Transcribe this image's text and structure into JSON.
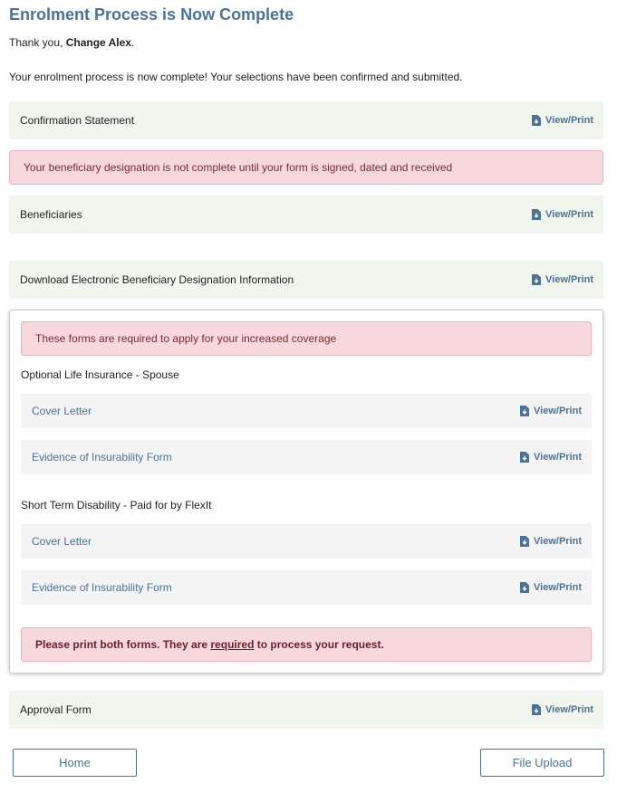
{
  "page": {
    "title": "Enrolment Process is Now Complete",
    "thanks_prefix": "Thank you, ",
    "user_name": "Change Alex",
    "thanks_suffix": ".",
    "intro": "Your enrolment process is now complete! Your selections have been confirmed and submitted."
  },
  "view_print_label": "View/Print",
  "sections": {
    "confirmation": "Confirmation Statement",
    "beneficiary_alert": "Your beneficiary designation is not complete until your form is signed, dated and received",
    "beneficiaries": "Beneficiaries",
    "download_beneficiary": "Download Electronic Beneficiary Designation Information",
    "approval": "Approval Form"
  },
  "forms_panel": {
    "alert": "These forms are required to apply for your increased coverage",
    "groups": [
      {
        "title": "Optional Life Insurance - Spouse",
        "items": [
          "Cover Letter",
          "Evidence of Insurability Form"
        ]
      },
      {
        "title": "Short Term Disability - Paid for by FlexIt",
        "items": [
          "Cover Letter",
          "Evidence of Insurability Form"
        ]
      }
    ],
    "print_notice_part1": "Please print both forms. They are ",
    "print_notice_required": "required",
    "print_notice_part2": " to process your request."
  },
  "buttons": {
    "home": "Home",
    "file_upload": "File Upload"
  },
  "colors": {
    "accent": "#4a7396",
    "row_bg": "#f1f6ee",
    "alert_bg": "#f7d9dd",
    "alert_text": "#7a2a30"
  },
  "icons": {
    "view_print": "document-download-icon"
  }
}
